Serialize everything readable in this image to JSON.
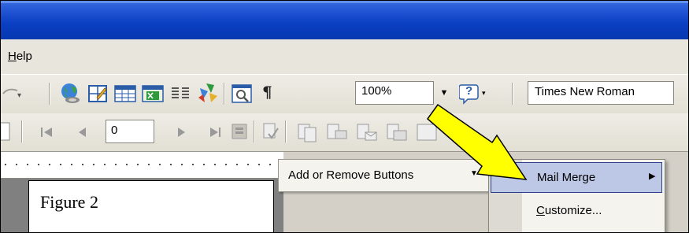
{
  "menubar": {
    "help": {
      "accel": "H",
      "rest": "elp"
    }
  },
  "toolbar": {
    "zoom": {
      "value": "100%"
    },
    "font": {
      "value": "Times New Roman"
    },
    "mailmerge_record": {
      "value": "0"
    },
    "paragraph_glyph": "¶",
    "help_glyph": "?"
  },
  "document": {
    "figure_label": "Figure 2"
  },
  "add_remove": {
    "label": "Add or Remove Buttons"
  },
  "submenu": {
    "mail_merge": "Mail Merge",
    "customize": {
      "accel": "C",
      "rest": "ustomize..."
    }
  },
  "colors": {
    "arrow_yellow": "#ffff00",
    "title_blue": "#0a3fc2",
    "menu_highlight": "#bdc7e6"
  }
}
